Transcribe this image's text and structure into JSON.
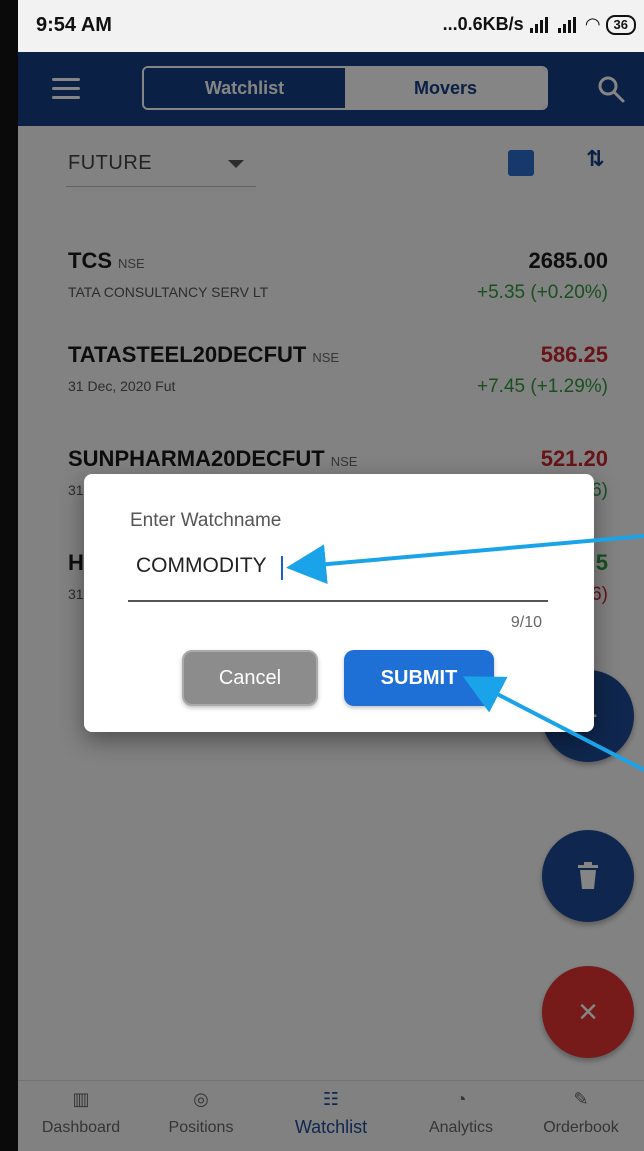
{
  "statusbar": {
    "time": "9:54 AM",
    "network": "...0.6KB/s",
    "battery": "36"
  },
  "appbar": {
    "tabs": [
      "Watchlist",
      "Movers"
    ],
    "active_tab": "Watchlist"
  },
  "filter": {
    "exchange": "FUTURE"
  },
  "watchlist": [
    {
      "symbol": "TCS",
      "exchange": "NSE",
      "description": "TATA CONSULTANCY SERV LT",
      "ltp": "2685.00",
      "change": "+5.35 (+0.20%)",
      "ltp_color": "#1a1a1a",
      "change_color": "#2e9b3c"
    },
    {
      "symbol": "TATASTEEL20DECFUT",
      "exchange": "NSE",
      "description": "31 Dec, 2020 Fut",
      "ltp": "586.25",
      "change": "+7.45 (+1.29%)",
      "ltp_color": "#c8282e",
      "change_color": "#2e9b3c"
    },
    {
      "symbol": "SUNPHARMA20DECFUT",
      "exchange": "NSE",
      "description": "31",
      "ltp": "521.20",
      "change": "6)",
      "ltp_color": "#c8282e",
      "change_color": "#2e9b3c"
    },
    {
      "symbol": "H",
      "exchange": "",
      "description": "31",
      "ltp": "5",
      "change": "6)",
      "ltp_color": "#2e9b3c",
      "change_color": "#c8282e"
    }
  ],
  "dialog": {
    "title": "Enter Watchname",
    "input_value": "COMMODITY",
    "counter": "9/10",
    "cancel_label": "Cancel",
    "submit_label": "SUBMIT"
  },
  "fabs": {
    "add": "+",
    "delete": "trash-icon",
    "close": "×"
  },
  "bottom_nav": [
    {
      "label": "Dashboard",
      "icon": "dashboard-icon",
      "active": false
    },
    {
      "label": "Positions",
      "icon": "compass-icon",
      "active": false
    },
    {
      "label": "Watchlist",
      "icon": "list-icon",
      "active": true
    },
    {
      "label": "Analytics",
      "icon": "pie-icon",
      "active": false
    },
    {
      "label": "Orderbook",
      "icon": "edit-icon",
      "active": false
    }
  ],
  "colors": {
    "primary": "#143f84",
    "accent": "#1e6fd6",
    "danger": "#e23431",
    "positive": "#2e9b3c",
    "annotation": "#1aa3e8"
  }
}
